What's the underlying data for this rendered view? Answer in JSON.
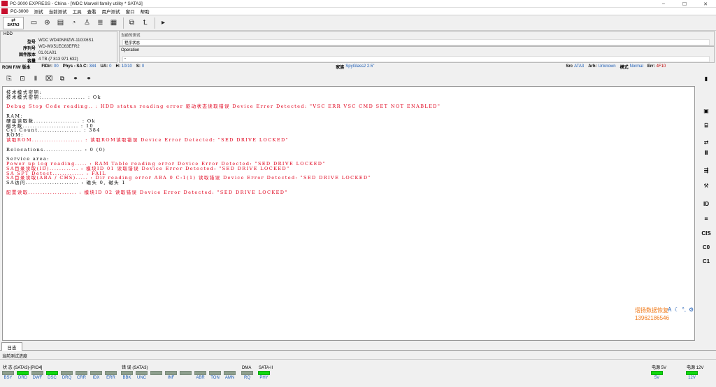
{
  "window": {
    "title": "PC-3000 EXPRESS - China - [WDC Marvell family utility * SATA3]",
    "minimize": "–",
    "maximize": "☐",
    "close": "✕"
  },
  "menu": [
    "PC-3000",
    "测试",
    "当前测试",
    "工具",
    "查看",
    "用户测试",
    "窗口",
    "帮助"
  ],
  "toolbar": {
    "sata_label": "SATA3"
  },
  "hdd": {
    "title": "HDD",
    "rows": [
      {
        "label": "型号",
        "value": "WDC WD40NMZW-11GX6S1"
      },
      {
        "label": "序列号",
        "value": "WD-WX51EC63EFR2"
      },
      {
        "label": "固件版本",
        "value": "01.01A01"
      },
      {
        "label": "容量",
        "value": "4 TB (7 813 971 632)"
      }
    ]
  },
  "current_test": {
    "label": "当前的测试",
    "value": "程序状态"
  },
  "operation": {
    "label": "Operation",
    "value": "-"
  },
  "statusline": {
    "rom_key": "ROM F/W 版本",
    "fldir_key": "FlDir:",
    "fldir_val": "00",
    "phys_key": "Phys - SA C:",
    "phys_val": "384",
    "ua_key": "UA:",
    "ua_val": "0",
    "h_key": "H:",
    "h_val": "10/10",
    "s_key": "S:",
    "s_val": "0",
    "family_key": "家族",
    "family_val": "SpyGlass2 2.5\"",
    "src_key": "Src",
    "src_val": "ATA3",
    "arh_key": "Arh:",
    "arh_val": "Unknown",
    "mode_key": "模式",
    "mode_val": "Normal",
    "err_key": "Err:",
    "err_val": "4F10"
  },
  "log_lines": [
    {
      "t": "技术模式密钥:",
      "c": "black"
    },
    {
      "t": "技术模式密钥:.................. : Ok",
      "c": "black"
    },
    {
      "t": "",
      "c": "black"
    },
    {
      "t": "Debug Stop Code reading.. : HDD status reading error 驱动状态读取错误 Device Error Detected: \"VSC ERR VSC CMD SET NOT ENABLED\"",
      "c": "red"
    },
    {
      "t": "",
      "c": "black"
    },
    {
      "t": "RAM:",
      "c": "black"
    },
    {
      "t": "硬盘读取数................... : Ok",
      "c": "black"
    },
    {
      "t": "磁头数....................... : 10",
      "c": "black"
    },
    {
      "t": "Cyl Count.................. : 384",
      "c": "black"
    },
    {
      "t": "ROM:",
      "c": "black"
    },
    {
      "t": "读取ROM..................... : 读取ROM读取错误 Device Error Detected: \"SED DRIVE LOCKED\"",
      "c": "red"
    },
    {
      "t": "",
      "c": "black"
    },
    {
      "t": "Relocations................ : 0 (0)",
      "c": "black"
    },
    {
      "t": "",
      "c": "black"
    },
    {
      "t": "Service area:",
      "c": "black"
    },
    {
      "t": "Power up log reading..... : RAM Table reading error Device Error Detected: \"SED DRIVE LOCKED\"",
      "c": "red"
    },
    {
      "t": "SA目录读取(ID)............ : 模块ID 01 读取错误 Device Error Detected: \"SED DRIVE LOCKED\"",
      "c": "red"
    },
    {
      "t": "SA SPT Detect............. : FAIL",
      "c": "red"
    },
    {
      "t": "SA目录读取(ABA / CHS)..... : Dir reading error ABA 0 C:1(1) 读取错误 Device Error Detected: \"SED DRIVE LOCKED\"",
      "c": "red"
    },
    {
      "t": "SA访问...................... : 磁头 0, 磁头 1",
      "c": "black"
    },
    {
      "t": "",
      "c": "black"
    },
    {
      "t": "配置读取.................... : 模块ID 02 读取错误 Device Error Detected: \"SED DRIVE LOCKED\"",
      "c": "red"
    }
  ],
  "watermark": {
    "line1": "熠扬数据恢复",
    "line2": "13962186546"
  },
  "ime": [
    "A",
    "☾",
    "°,",
    "⚙"
  ],
  "right_toolbar": [
    "▮",
    "▣",
    "⌸",
    "⇄",
    "Ⅱ",
    "⇶",
    "⚒",
    "ID",
    "⌗",
    "CIS",
    "C0",
    "C1"
  ],
  "bottom": {
    "tab_log": "日志",
    "progress_label": "当前测试进度"
  },
  "indicators": {
    "status": {
      "title": "状 态 (SATA3)-[PIO4]",
      "items": [
        {
          "name": "BSY",
          "on": false
        },
        {
          "name": "DRD",
          "on": true
        },
        {
          "name": "DWF",
          "on": false
        },
        {
          "name": "DSC",
          "on": true
        },
        {
          "name": "DRQ",
          "on": false
        },
        {
          "name": "CRR",
          "on": false
        },
        {
          "name": "IDX",
          "on": false
        },
        {
          "name": "ERR",
          "on": false
        }
      ]
    },
    "error": {
      "title": "错 误 (SATA3)",
      "items": [
        {
          "name": "BBK",
          "on": false
        },
        {
          "name": "UNC",
          "on": false
        },
        {
          "name": "",
          "on": false
        },
        {
          "name": "INF",
          "on": false
        },
        {
          "name": "",
          "on": false
        },
        {
          "name": "ABR",
          "on": false
        },
        {
          "name": "TON",
          "on": false
        },
        {
          "name": "AMN",
          "on": false
        }
      ]
    },
    "dma": {
      "title": "DMA",
      "items": [
        {
          "name": "RQ",
          "on": false
        }
      ]
    },
    "sata": {
      "title": "SATA-II",
      "items": [
        {
          "name": "PHY",
          "on": true
        }
      ]
    },
    "p5": {
      "title": "电源 5V",
      "items": [
        {
          "name": "5V",
          "on": true
        }
      ]
    },
    "p12": {
      "title": "电源 12V",
      "items": [
        {
          "name": "12V",
          "on": true
        }
      ]
    }
  },
  "colors": {
    "accent_red": "#e0001b",
    "lamp_on": "#11d811",
    "link_blue": "#1a5bb5"
  }
}
